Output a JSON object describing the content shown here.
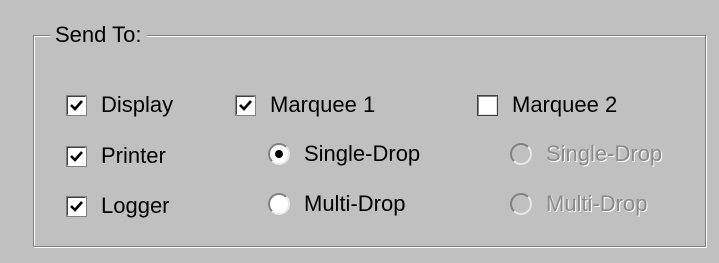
{
  "group": {
    "title": "Send To:"
  },
  "checkboxes": {
    "display": {
      "label": "Display",
      "checked": true
    },
    "printer": {
      "label": "Printer",
      "checked": true
    },
    "logger": {
      "label": "Logger",
      "checked": true
    },
    "marquee1": {
      "label": "Marquee 1",
      "checked": true
    },
    "marquee2": {
      "label": "Marquee 2",
      "checked": false
    }
  },
  "marquee1_mode": {
    "single": {
      "label": "Single-Drop",
      "selected": true,
      "enabled": true
    },
    "multi": {
      "label": "Multi-Drop",
      "selected": false,
      "enabled": true
    }
  },
  "marquee2_mode": {
    "single": {
      "label": "Single-Drop",
      "selected": false,
      "enabled": false
    },
    "multi": {
      "label": "Multi-Drop",
      "selected": false,
      "enabled": false
    }
  },
  "colors": {
    "dialog_background": "#c0c0c0",
    "disabled_text": "#8a8a8a"
  }
}
